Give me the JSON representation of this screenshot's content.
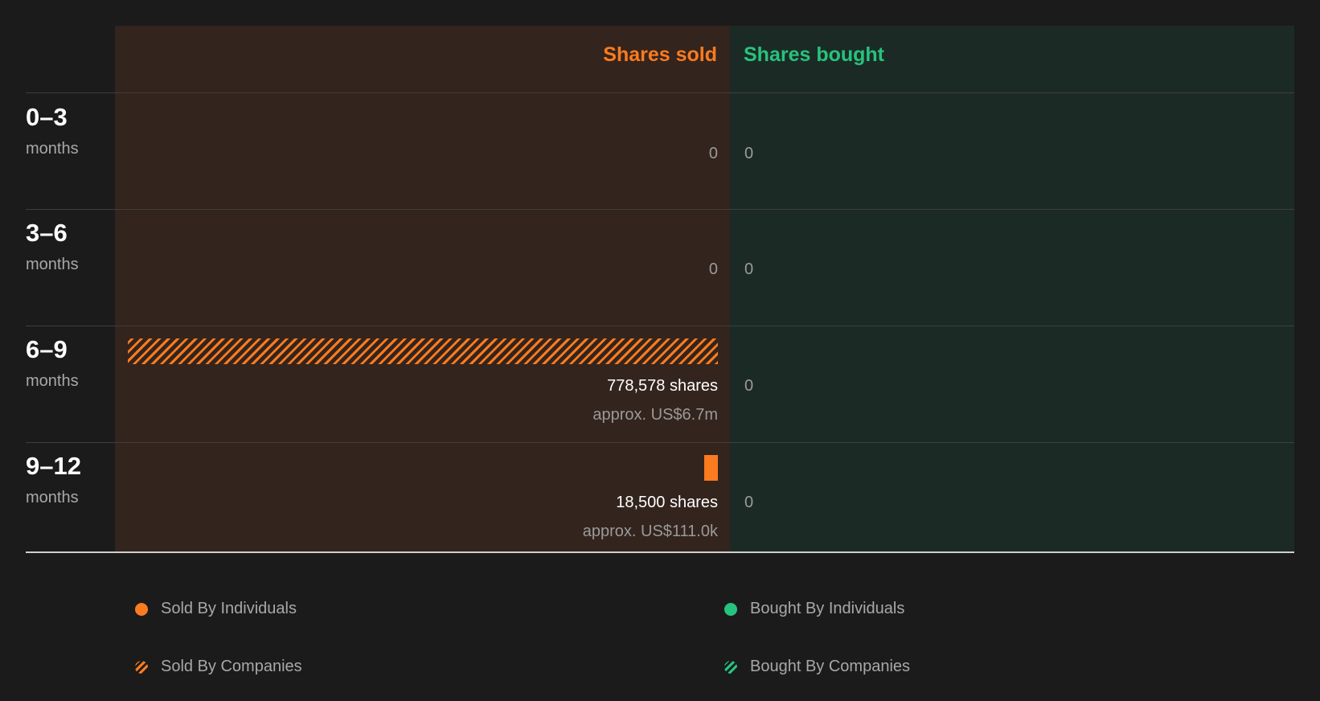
{
  "chart_data": {
    "type": "bar",
    "orientation": "horizontal",
    "headers": {
      "sold": "Shares sold",
      "bought": "Shares bought"
    },
    "unit_label": "months",
    "categories": [
      "0–3",
      "3–6",
      "6–9",
      "9–12"
    ],
    "rows": [
      {
        "period": "0–3",
        "unit": "months",
        "sold": {
          "total_shares": 0,
          "label": "0",
          "companies": 0,
          "individuals": 0
        },
        "bought": {
          "total_shares": 0,
          "label": "0"
        }
      },
      {
        "period": "3–6",
        "unit": "months",
        "sold": {
          "total_shares": 0,
          "label": "0",
          "companies": 0,
          "individuals": 0
        },
        "bought": {
          "total_shares": 0,
          "label": "0"
        }
      },
      {
        "period": "6–9",
        "unit": "months",
        "sold": {
          "total_shares": 778578,
          "label": "778,578 shares",
          "approx": "approx. US$6.7m",
          "companies": 778578,
          "individuals": 0
        },
        "bought": {
          "total_shares": 0,
          "label": "0"
        }
      },
      {
        "period": "9–12",
        "unit": "months",
        "sold": {
          "total_shares": 18500,
          "label": "18,500 shares",
          "approx": "approx. US$111.0k",
          "companies": 0,
          "individuals": 18500
        },
        "bought": {
          "total_shares": 0,
          "label": "0"
        }
      }
    ],
    "series": [
      {
        "name": "Sold By Individuals",
        "color": "#fb7b1f",
        "pattern": "solid",
        "values": [
          0,
          0,
          0,
          18500
        ]
      },
      {
        "name": "Bought By Individuals",
        "color": "#26c37e",
        "pattern": "solid",
        "values": [
          0,
          0,
          0,
          0
        ]
      },
      {
        "name": "Sold By Companies",
        "color": "#fb7b1f",
        "pattern": "hatched",
        "values": [
          0,
          0,
          778578,
          0
        ]
      },
      {
        "name": "Bought By Companies",
        "color": "#26c37e",
        "pattern": "hatched",
        "values": [
          0,
          0,
          0,
          0
        ]
      }
    ],
    "legend": [
      "Sold By Individuals",
      "Bought By Individuals",
      "Sold By Companies",
      "Bought By Companies"
    ],
    "legend_placement": "bottom",
    "colors": {
      "sold": "#fb7b1f",
      "bought": "#26c37e",
      "sold_panel": "#33241d",
      "bought_panel": "#1c2a25",
      "background": "#1b1b1b"
    }
  }
}
